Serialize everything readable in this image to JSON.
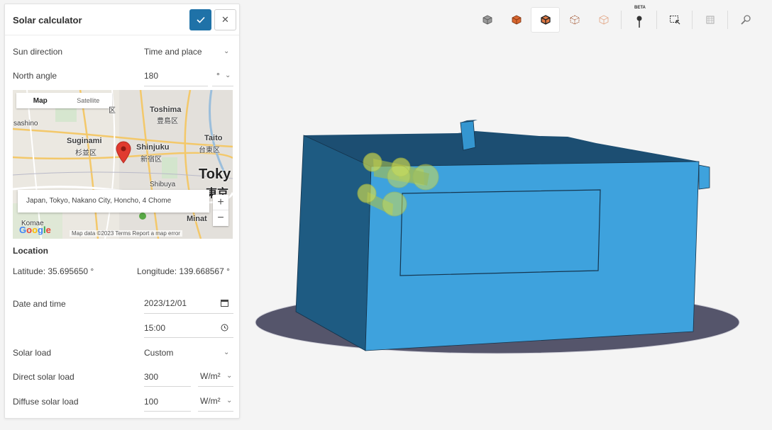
{
  "panel": {
    "title": "Solar calculator",
    "confirm_icon": "check-icon",
    "close_icon": "close-icon"
  },
  "form": {
    "sun_direction": {
      "label": "Sun direction",
      "value": "Time and place"
    },
    "north_angle": {
      "label": "North angle",
      "value": "180",
      "unit": "°"
    },
    "location_title": "Location",
    "latitude": "Latitude: 35.695650 °",
    "longitude": "Longitude: 139.668567 °",
    "date_time": {
      "label": "Date and time",
      "date": "2023/12/01",
      "time": "15:00"
    },
    "solar_load": {
      "label": "Solar load",
      "value": "Custom"
    },
    "direct_solar_load": {
      "label": "Direct solar load",
      "value": "300",
      "unit": "W/m²"
    },
    "diffuse_solar_load": {
      "label": "Diffuse solar load",
      "value": "100",
      "unit": "W/m²"
    }
  },
  "map": {
    "tab_map": "Map",
    "tab_satellite": "Satellite",
    "address": "Japan, Tokyo, Nakano City, Honcho, 4 Chome",
    "labels": {
      "toshima": "Toshima",
      "toshima_jp": "豊島区",
      "suginami": "Suginami",
      "suginami_jp": "杉並区",
      "shinjuku": "Shinjuku",
      "shinjuku_jp": "新宿区",
      "taito": "Taito",
      "taito_jp": "台東区",
      "tokyo": "Toky",
      "tokyo_jp": "東京",
      "sashino": "sashino",
      "shibuya": "Shibuya",
      "minato": "Minat",
      "komae": "Komae",
      "ku_top": "区"
    },
    "zoom_in": "+",
    "zoom_out": "−",
    "google": "Google",
    "footer": "Map data ©2023   Terms   Report a map error"
  },
  "toolbar": {
    "tools": [
      {
        "name": "view-cube-icon",
        "active": false
      },
      {
        "name": "solid-cube-icon",
        "active": false
      },
      {
        "name": "shaded-cube-icon",
        "active": true
      },
      {
        "name": "wireframe-cube-icon",
        "active": false
      },
      {
        "name": "transparent-cube-icon",
        "active": false
      }
    ],
    "beta_label": "BETA"
  },
  "colors": {
    "accent": "#1f72a8",
    "building_front": "#3ea2dd",
    "building_side": "#1e5b82",
    "building_top": "#1c4e72",
    "shadow": "#4f4f63",
    "highlight": "#d9e14a",
    "pin": "#e03a2f"
  }
}
